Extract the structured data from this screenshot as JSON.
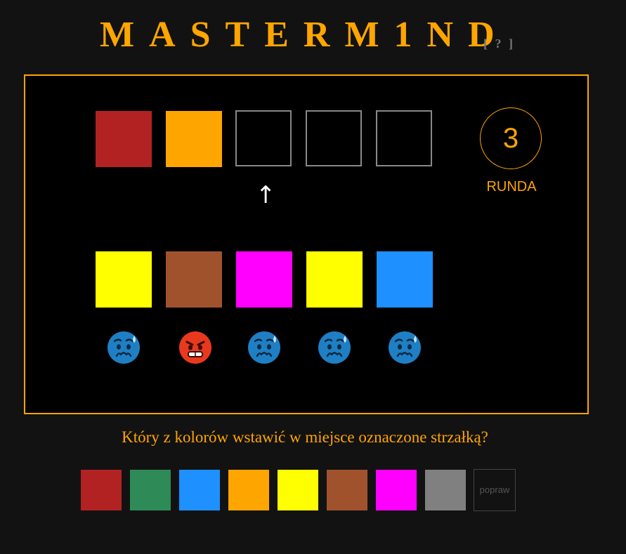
{
  "header": {
    "title": "MASTERM1ND",
    "help": "[ ? ]"
  },
  "colors": {
    "accent": "#ffa500",
    "background": "#121212",
    "board": "#000000",
    "empty_border": "#888888"
  },
  "guess": {
    "slots": [
      "#b22222",
      "#ffa500",
      null,
      null,
      null
    ],
    "arrow": "↑",
    "arrow_slot": 3
  },
  "round": {
    "number": "3",
    "label": "RUNDA"
  },
  "reference": {
    "slots": [
      "#ffff00",
      "#a0522d",
      "#ff00ff",
      "#ffff00",
      "#1e90ff"
    ],
    "feedback": [
      {
        "icon": "worried-sweat-face-icon",
        "color": "#1f7fc4"
      },
      {
        "icon": "angry-face-icon",
        "color": "#e8391e"
      },
      {
        "icon": "worried-sweat-face-icon",
        "color": "#1f7fc4"
      },
      {
        "icon": "worried-sweat-face-icon",
        "color": "#1f7fc4"
      },
      {
        "icon": "worried-sweat-face-icon",
        "color": "#1f7fc4"
      }
    ]
  },
  "question": "Który z kolorów wstawić w miejsce oznaczone strzałką?",
  "palette": {
    "colors": [
      "#b22222",
      "#2e8b57",
      "#1e90ff",
      "#ffa500",
      "#ffff00",
      "#a0522d",
      "#ff00ff",
      "#808080"
    ],
    "fix_label": "popraw"
  }
}
